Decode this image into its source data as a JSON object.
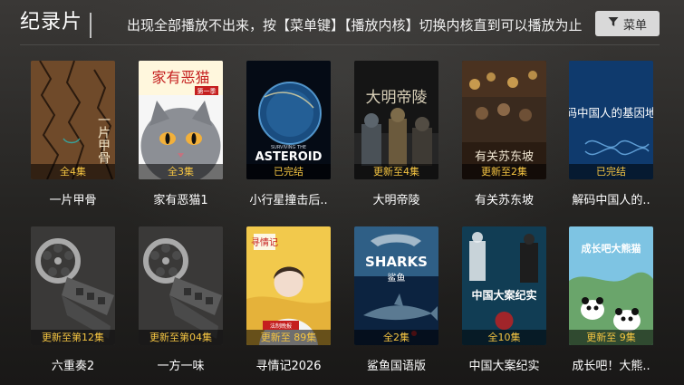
{
  "header": {
    "title": "纪录片",
    "notice": "出现全部播放不出来，按【菜单键】【播放内核】切换内核直到可以播放为止",
    "menu_label": "菜单"
  },
  "colors": {
    "background": "#1f1e1d",
    "badge_text": "#f5c542",
    "menu_button_bg": "#d9d9d9"
  },
  "videos": [
    {
      "title": "一片甲骨",
      "badge": "全4集",
      "poster_icon": "oracle-bone-poster"
    },
    {
      "title": "家有恶猫1",
      "badge": "全3集",
      "poster_icon": "cat-poster",
      "poster_text": "家有恶猫",
      "poster_sub": "第一季"
    },
    {
      "title": "小行星撞击后..",
      "badge": "已完结",
      "poster_icon": "asteroid-poster",
      "poster_text": "ASTEROID",
      "poster_sub": "SURVIVING THE"
    },
    {
      "title": "大明帝陵",
      "badge": "更新至4集",
      "poster_icon": "ming-tombs-poster",
      "poster_text": "大明帝陵"
    },
    {
      "title": "有关苏东坡",
      "badge": "更新至2集",
      "poster_icon": "su-dongpo-poster",
      "poster_text": "有关苏东坡"
    },
    {
      "title": "解码中国人的..",
      "badge": "已完结",
      "poster_icon": "dna-map-poster",
      "poster_text": "解码中国人的基因地图"
    },
    {
      "title": "六重奏2",
      "badge": "更新至第12集",
      "poster_icon": "film-reel-placeholder"
    },
    {
      "title": "一方一味",
      "badge": "更新至第04集",
      "poster_icon": "film-reel-placeholder"
    },
    {
      "title": "寻情记2026",
      "badge": "更新至 89集",
      "poster_icon": "xunqingji-poster",
      "poster_text": "寻情记",
      "poster_sub": "法制晚报"
    },
    {
      "title": "鲨鱼国语版",
      "badge": "全2集",
      "poster_icon": "sharks-poster",
      "poster_text": "SHARKS",
      "poster_sub": "鲨鱼"
    },
    {
      "title": "中国大案纪实",
      "badge": "全10集",
      "poster_icon": "crime-case-poster",
      "poster_text": "中国大案纪实"
    },
    {
      "title": "成长吧！大熊..",
      "badge": "更新至 9集",
      "poster_icon": "panda-poster",
      "poster_text": "成长吧大熊猫"
    }
  ]
}
